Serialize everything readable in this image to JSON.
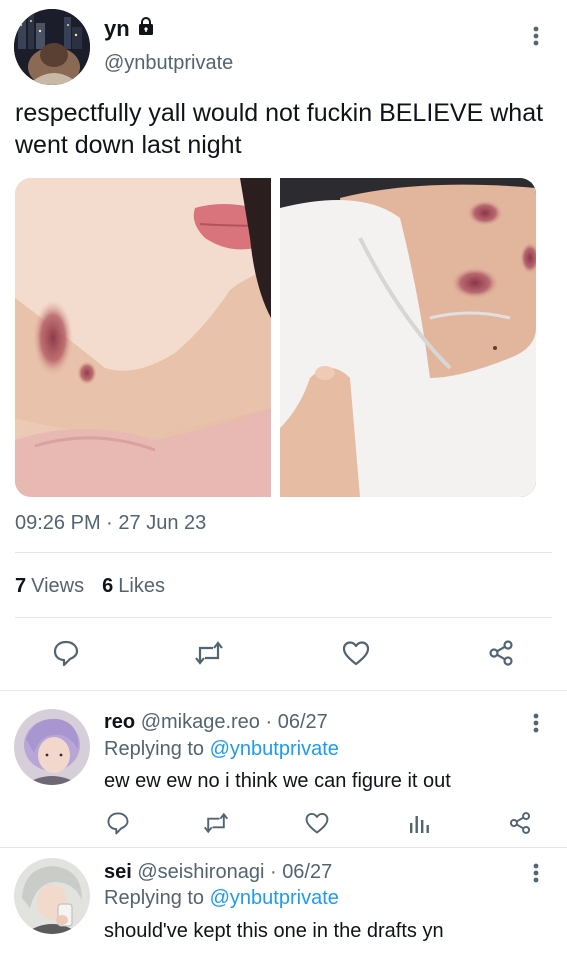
{
  "tweet": {
    "name": "yn",
    "handle": "@ynbutprivate",
    "text": "respectfully yall would not fuckin BELIEVE what went down last night",
    "time": "09:26 PM",
    "date": "27 Jun 23",
    "views_count": "7",
    "views_label": "Views",
    "likes_count": "6",
    "likes_label": "Likes"
  },
  "replies": [
    {
      "name": "reo",
      "handle": "@mikage.reo",
      "date": "06/27",
      "replying_prefix": "Replying to",
      "replying_to": "@ynbutprivate",
      "text": "ew ew ew no i think we can figure it out"
    },
    {
      "name": "sei",
      "handle": "@seishironagi",
      "date": "06/27",
      "replying_prefix": "Replying to",
      "replying_to": "@ynbutprivate",
      "text": "should've kept this one in the drafts yn"
    }
  ],
  "colors": {
    "text": "#0f1419",
    "secondary": "#536471",
    "link": "#1d9bf0",
    "divider": "#e1e6ea"
  },
  "icons": {
    "lock": "lock-icon",
    "more": "more-vertical-icon",
    "reply": "reply-icon",
    "retweet": "retweet-icon",
    "like": "heart-icon",
    "share": "share-icon",
    "stats": "analytics-icon"
  }
}
